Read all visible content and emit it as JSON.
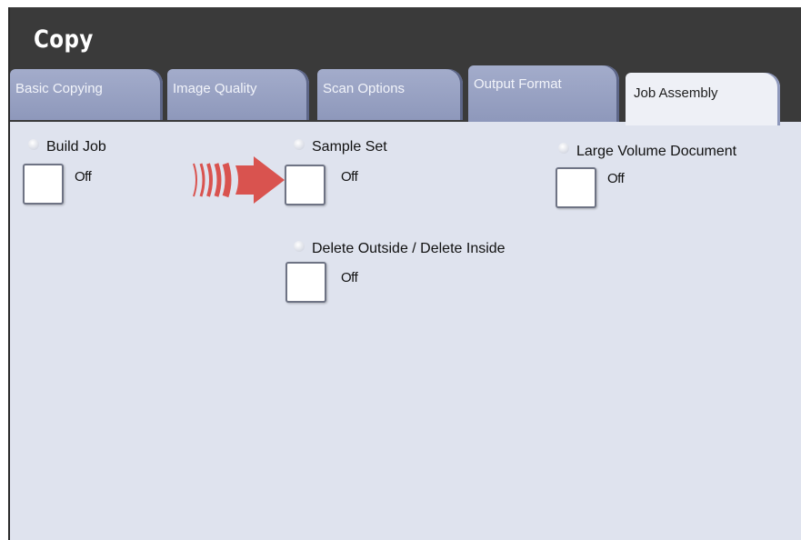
{
  "header": {
    "title": "Copy"
  },
  "tabs": [
    {
      "label": "Basic Copying",
      "active": false
    },
    {
      "label": "Image Quality",
      "active": false
    },
    {
      "label": "Scan Options",
      "active": false
    },
    {
      "label": "Output Format",
      "active": false
    },
    {
      "label": "Job Assembly",
      "active": true
    }
  ],
  "options": {
    "build_job": {
      "label": "Build Job",
      "state": "Off"
    },
    "sample_set": {
      "label": "Sample Set",
      "state": "Off"
    },
    "large_volume": {
      "label": "Large Volume Document",
      "state": "Off"
    },
    "delete_outside_inside": {
      "label": "Delete Outside / Delete Inside",
      "state": "Off"
    }
  },
  "colors": {
    "header_bg": "#3a3a3a",
    "panel_bg": "#dfe3ee",
    "tab_inactive": "#96a0c2",
    "tab_active": "#eef0f6",
    "arrow": "#d9534f"
  },
  "icons": {
    "pointer": "red-arrow-icon"
  }
}
